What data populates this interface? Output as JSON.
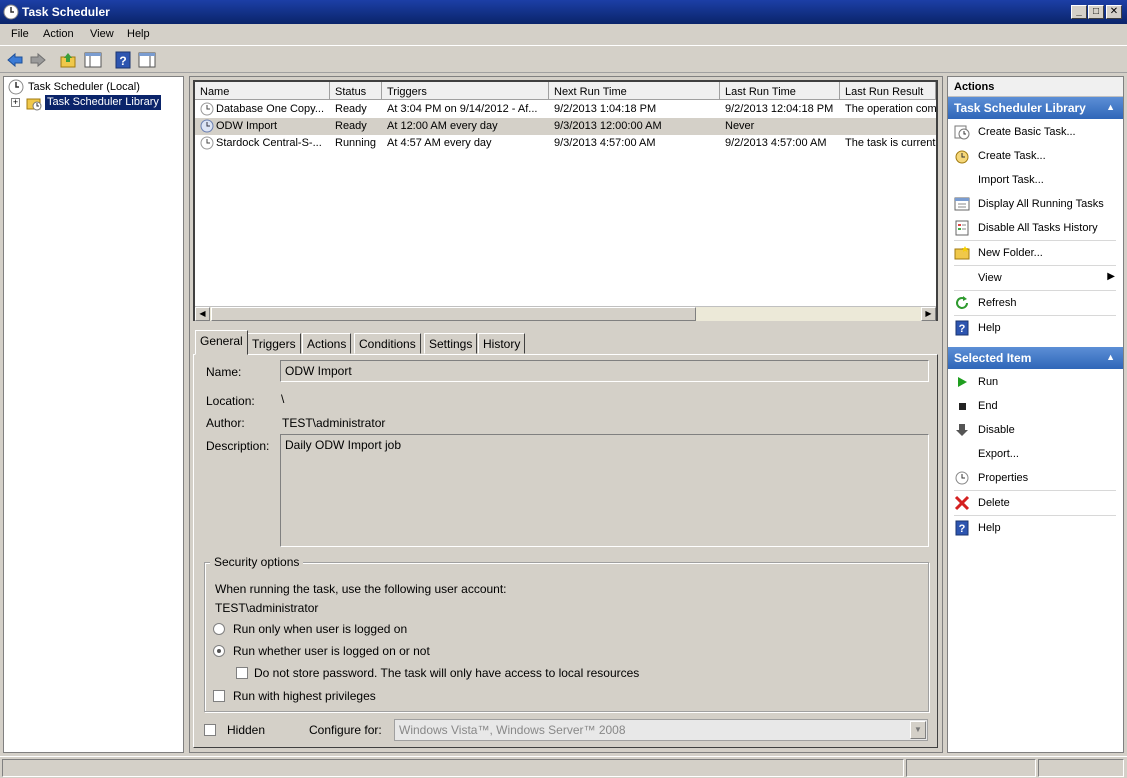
{
  "window": {
    "title": "Task Scheduler"
  },
  "menu": [
    "File",
    "Action",
    "View",
    "Help"
  ],
  "tree": {
    "root": "Task Scheduler (Local)",
    "library": "Task Scheduler Library",
    "expander": "+"
  },
  "tasklist": {
    "columns": [
      "Name",
      "Status",
      "Triggers",
      "Next Run Time",
      "Last Run Time",
      "Last Run Result"
    ],
    "rows": [
      {
        "name": "Database One Copy...",
        "status": "Ready",
        "triggers": "At 3:04 PM on 9/14/2012 - Af...",
        "next_run": "9/2/2013 1:04:18 PM",
        "last_run": "9/2/2013 12:04:18 PM",
        "result": "The operation comp",
        "selected": false
      },
      {
        "name": "ODW Import",
        "status": "Ready",
        "triggers": "At 12:00 AM every day",
        "next_run": "9/3/2013 12:00:00 AM",
        "last_run": "Never",
        "result": "",
        "selected": true
      },
      {
        "name": "Stardock Central-S-...",
        "status": "Running",
        "triggers": "At 4:57 AM every day",
        "next_run": "9/3/2013 4:57:00 AM",
        "last_run": "9/2/2013 4:57:00 AM",
        "result": "The task is currently",
        "selected": false
      }
    ]
  },
  "tabs": [
    "General",
    "Triggers",
    "Actions",
    "Conditions",
    "Settings",
    "History"
  ],
  "active_tab": "General",
  "general": {
    "name_label": "Name:",
    "name_value": "ODW Import",
    "location_label": "Location:",
    "location_value": "\\",
    "author_label": "Author:",
    "author_value": "TEST\\administrator",
    "description_label": "Description:",
    "description_value": "Daily ODW Import job",
    "security": {
      "legend": "Security options",
      "account_prompt": "When running the task, use the following user account:",
      "account": "TEST\\administrator",
      "radio_logged_on": "Run only when user is logged on",
      "radio_whether": "Run whether user is logged on or not",
      "selected_radio": "Run whether user is logged on or not",
      "no_store_password": "Do not store password.  The task will only have access to local resources",
      "highest_privileges": "Run with highest privileges"
    },
    "hidden_label": "Hidden",
    "configure_label": "Configure for:",
    "configure_value": "Windows Vista™, Windows Server™ 2008"
  },
  "actions_pane": {
    "title": "Actions",
    "section_library": "Task Scheduler Library",
    "library_items": [
      {
        "label": "Create Basic Task...",
        "icon": "create-basic-task-icon"
      },
      {
        "label": "Create Task...",
        "icon": "create-task-icon"
      },
      {
        "label": "Import Task...",
        "icon": ""
      },
      {
        "label": "Display All Running Tasks",
        "icon": "running-tasks-icon"
      },
      {
        "label": "Disable All Tasks History",
        "icon": "history-icon"
      },
      {
        "label": "New Folder...",
        "icon": "folder-icon"
      },
      {
        "label": "View",
        "icon": ""
      },
      {
        "label": "Refresh",
        "icon": "refresh-icon"
      },
      {
        "label": "Help",
        "icon": "help-icon"
      }
    ],
    "section_selected": "Selected Item",
    "selected_items": [
      {
        "label": "Run",
        "icon": "run-icon"
      },
      {
        "label": "End",
        "icon": "end-icon"
      },
      {
        "label": "Disable",
        "icon": "disable-icon"
      },
      {
        "label": "Export...",
        "icon": ""
      },
      {
        "label": "Properties",
        "icon": "properties-icon"
      },
      {
        "label": "Delete",
        "icon": "delete-icon"
      },
      {
        "label": "Help",
        "icon": "help-icon"
      }
    ]
  },
  "colors": {
    "accent": "#2f66b8",
    "titlebar": "#0a246a",
    "delete": "#d42020",
    "run": "#1f9e1f"
  }
}
